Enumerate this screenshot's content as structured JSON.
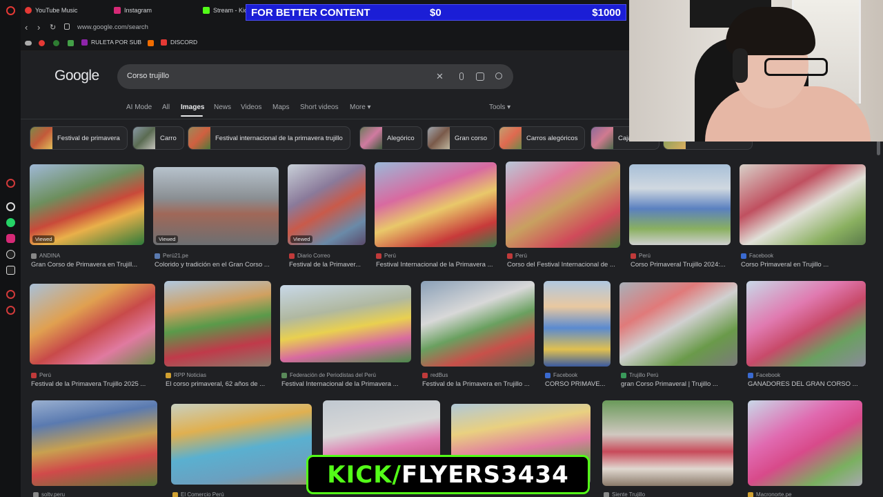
{
  "browser": {
    "tabs": [
      {
        "label": "YouTube Music",
        "color": "#e53935"
      },
      {
        "label": "Instagram",
        "color": "#d62976"
      },
      {
        "label": "Stream - Kick",
        "color": "#53fc18"
      }
    ],
    "url": "www.google.com/search",
    "bookmarks": [
      {
        "label": "RULETA POR SUB",
        "color": "#8e24aa"
      },
      {
        "label": "DISCORD",
        "color": "#e53935"
      }
    ]
  },
  "google": {
    "logo": "Google",
    "query": "Corso trujillo",
    "nav_tabs": [
      "AI Mode",
      "All",
      "Images",
      "News",
      "Videos",
      "Maps",
      "Short videos",
      "More ▾"
    ],
    "active_tab": "Images",
    "tools": "Tools ▾",
    "chips": [
      "Festival de primavera",
      "Carro",
      "Festival internacional de la primavera trujillo",
      "Alegórico",
      "Gran corso",
      "Carros alegóricos",
      "Caja"
    ]
  },
  "results": [
    {
      "source": "ANDINA",
      "title": "Gran Corso de Primavera en Trujill...",
      "viewed": "Viewed"
    },
    {
      "source": "Perú21.pe",
      "title": "Colorido y tradición en el Gran Corso ...",
      "viewed": "Viewed"
    },
    {
      "source": "Diario Correo",
      "title": "Festival de la Primaver...",
      "viewed": "Viewed"
    },
    {
      "source": "Perú",
      "title": "Festival Internacional de la Primavera ...",
      "viewed": ""
    },
    {
      "source": "Perú",
      "title": "Corso del Festival Internacional de ...",
      "viewed": ""
    },
    {
      "source": "Perú",
      "title": "Corso Primaveral Trujillo 2024:...",
      "viewed": ""
    },
    {
      "source": "Facebook",
      "title": "Corso Primaveral en Trujillo ...",
      "viewed": ""
    },
    {
      "source": "Perú",
      "title": "Festival de la Primavera Trujillo 2025 ...",
      "viewed": ""
    },
    {
      "source": "RPP Noticias",
      "title": "El corso primaveral, 62 años de ...",
      "viewed": ""
    },
    {
      "source": "Federación de Periodistas del Perú",
      "title": "Festival Internacional de la Primavera ...",
      "viewed": ""
    },
    {
      "source": "redBus",
      "title": "Festival de la Primavera en Trujillo ...",
      "viewed": ""
    },
    {
      "source": "Facebook",
      "title": "CORSO PRIMAVE...",
      "viewed": ""
    },
    {
      "source": "Trujillo Perú",
      "title": "gran Corso Primaveral | Trujillo ...",
      "viewed": ""
    },
    {
      "source": "Facebook",
      "title": "GANADORES DEL GRAN CORSO ...",
      "viewed": ""
    },
    {
      "source": "soltv.peru",
      "title": "",
      "viewed": ""
    },
    {
      "source": "El Comercio Perú",
      "title": "",
      "viewed": ""
    },
    {
      "source": "",
      "title": "",
      "viewed": ""
    },
    {
      "source": "",
      "title": "",
      "viewed": ""
    },
    {
      "source": "Siente Trujillo",
      "title": "",
      "viewed": ""
    },
    {
      "source": "Macronorte.pe",
      "title": "",
      "viewed": ""
    }
  ],
  "overlays": {
    "goal_label": "FOR BETTER CONTENT",
    "goal_current": "$0",
    "goal_target": "$1000",
    "kick_prefix": "KICK/",
    "kick_name": "FLYERS3434"
  }
}
